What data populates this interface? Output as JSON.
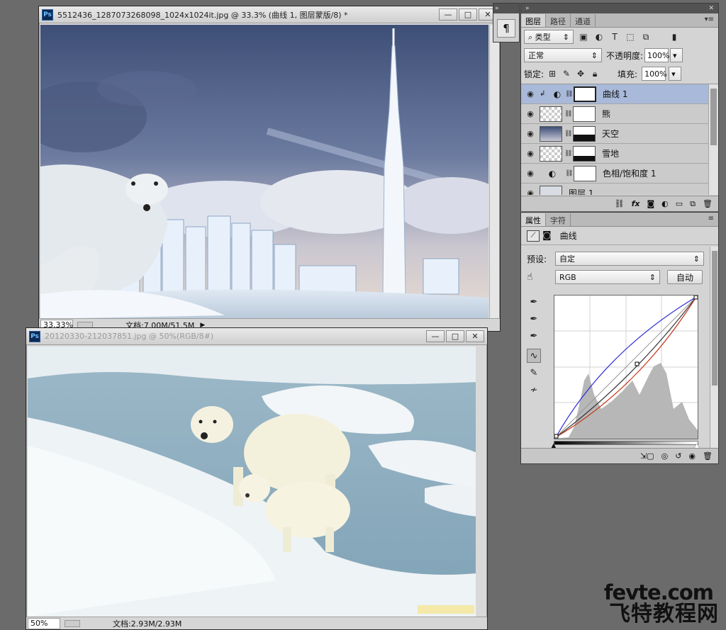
{
  "doc1": {
    "title": "5512436_1287073268098_1024x1024it.jpg @ 33.3% (曲线 1, 图层蒙版/8) *",
    "zoom": "33.33%",
    "doc_size": "文档:7.00M/51.5M"
  },
  "doc2": {
    "title": "20120330-212037851.jpg @ 50%(RGB/8#)",
    "zoom": "50%",
    "doc_size": "文档:2.93M/2.93M"
  },
  "window_buttons": {
    "minimize": "—",
    "restore": "□",
    "close": "✕"
  },
  "paragraph_panel": {
    "icon_label": "¶",
    "collapse": "»"
  },
  "layers_panel": {
    "tabs": [
      "图层",
      "路径",
      "通道"
    ],
    "filter_kind": "类型",
    "blend_mode": "正常",
    "opacity_label": "不透明度:",
    "opacity_value": "100%",
    "lock_label": "锁定:",
    "fill_label": "填充:",
    "fill_value": "100%",
    "layers": [
      {
        "name": "曲线 1",
        "selected": true
      },
      {
        "name": "熊",
        "selected": false
      },
      {
        "name": "天空",
        "selected": false
      },
      {
        "name": "雪地",
        "selected": false
      },
      {
        "name": "色相/饱和度 1",
        "selected": false
      },
      {
        "name": "图层 1",
        "selected": false
      }
    ],
    "bottom_icons": [
      "link-icon",
      "fx-icon",
      "mask-icon",
      "adjustment-icon",
      "folder-icon",
      "new-layer-icon",
      "trash-icon"
    ],
    "fx_label": "fx"
  },
  "properties_panel": {
    "tabs": [
      "属性",
      "字符"
    ],
    "title": "曲线",
    "preset_label": "预设:",
    "preset_value": "自定",
    "channel_value": "RGB",
    "auto_button": "自动"
  },
  "watermark": {
    "en": "fevte.com",
    "cn": "飞特教程网"
  },
  "colors": {
    "selected_layer": "#a9b9d9",
    "panel_bg": "#d4d4d4",
    "workspace": "#6b6b6b"
  }
}
